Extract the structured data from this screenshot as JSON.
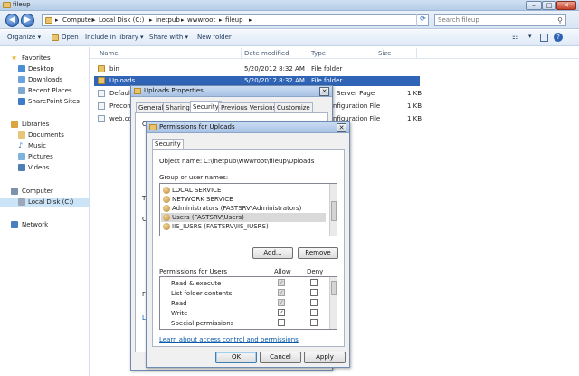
{
  "window": {
    "title": "fileup",
    "minimize": "–",
    "maximize": "□",
    "close": "✕"
  },
  "address": {
    "crumbs": [
      "Computer",
      "Local Disk (C:)",
      "inetpub",
      "wwwroot",
      "fileup"
    ],
    "separator": "▸",
    "search_placeholder": "Search fileup"
  },
  "toolbar": {
    "organize": "Organize ▾",
    "open": "Open",
    "include": "Include in library ▾",
    "share": "Share with ▾",
    "new_folder": "New folder"
  },
  "nav": {
    "favorites": "Favorites",
    "desktop": "Desktop",
    "downloads": "Downloads",
    "recent": "Recent Places",
    "sharepoint": "SharePoint Sites",
    "libraries": "Libraries",
    "documents": "Documents",
    "music": "Music",
    "pictures": "Pictures",
    "videos": "Videos",
    "computer": "Computer",
    "local_disk": "Local Disk (C:)",
    "network": "Network"
  },
  "columns": {
    "name": "Name",
    "date": "Date modified",
    "type": "Type",
    "size": "Size"
  },
  "files": [
    {
      "name": "bin",
      "date": "5/20/2012 8:32 AM",
      "type": "File folder",
      "size": ""
    },
    {
      "name": "Uploads",
      "date": "5/20/2012 8:32 AM",
      "type": "File folder",
      "size": ""
    },
    {
      "name": "Default",
      "date": "",
      "type": "Server Page",
      "size": "1 KB"
    },
    {
      "name": "Precon",
      "date": "",
      "type": "nfiguration File",
      "size": "1 KB"
    },
    {
      "name": "web.co",
      "date": "",
      "type": "nfiguration File",
      "size": "1 KB"
    }
  ],
  "properties": {
    "title": "Uploads Properties",
    "tabs": [
      "General",
      "Sharing",
      "Security",
      "Previous Versions",
      "Customize"
    ],
    "fragments": [
      "C",
      "T",
      "C",
      "F",
      "L"
    ]
  },
  "permissions": {
    "title": "Permissions for Uploads",
    "tab": "Security",
    "object_label": "Object name:",
    "object_value": "C:\\inetpub\\wwwroot\\fileup\\Uploads",
    "group_label": "Group or user names:",
    "users": [
      "LOCAL SERVICE",
      "NETWORK SERVICE",
      "Administrators (FASTSRV\\Administrators)",
      "Users (FASTSRV\\Users)",
      "IIS_IUSRS (FASTSRV\\IIS_IUSRS)"
    ],
    "add": "Add...",
    "remove": "Remove",
    "perm_label": "Permissions for Users",
    "allow": "Allow",
    "deny": "Deny",
    "perms": [
      {
        "name": "Read & execute",
        "allow": true,
        "deny": false
      },
      {
        "name": "List folder contents",
        "allow": true,
        "deny": false
      },
      {
        "name": "Read",
        "allow": true,
        "deny": false
      },
      {
        "name": "Write",
        "allow": true,
        "deny": false
      },
      {
        "name": "Special permissions",
        "allow": false,
        "deny": false
      }
    ],
    "check_mark": "✓",
    "link": "Learn about access control and permissions",
    "ok": "OK",
    "cancel": "Cancel",
    "apply": "Apply",
    "close": "✕"
  }
}
